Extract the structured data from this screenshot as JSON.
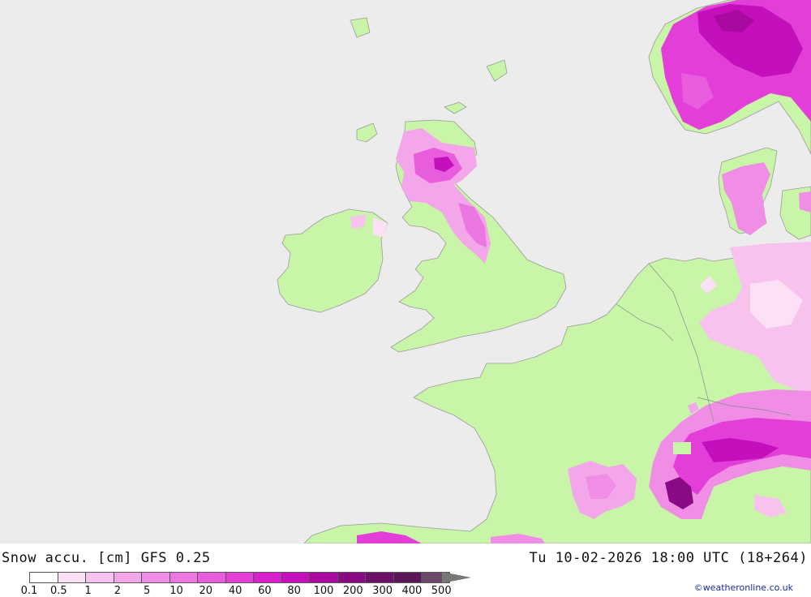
{
  "header": {
    "left_title": "Snow accu. [cm] GFS 0.25",
    "right_title": "Tu 10-02-2026 18:00 UTC (18+264)"
  },
  "legend": {
    "labels": [
      "0.1",
      "0.5",
      "1",
      "2",
      "5",
      "10",
      "20",
      "40",
      "60",
      "80",
      "100",
      "200",
      "300",
      "400",
      "500"
    ],
    "colors": [
      "#ffffff",
      "#fce0f6",
      "#f8c2ef",
      "#f4a6ea",
      "#f08ee6",
      "#ec76e2",
      "#e85cde",
      "#e33ed8",
      "#d81fce",
      "#c40fbc",
      "#a8099f",
      "#8a0a85",
      "#6e0f6a",
      "#5a1858",
      "#6a4a68"
    ]
  },
  "map": {
    "sea_color": "#ececec",
    "land_color": "#c8f5a8",
    "coast_color": "#a0a0a0"
  },
  "credit": "©weatheronline.co.uk"
}
